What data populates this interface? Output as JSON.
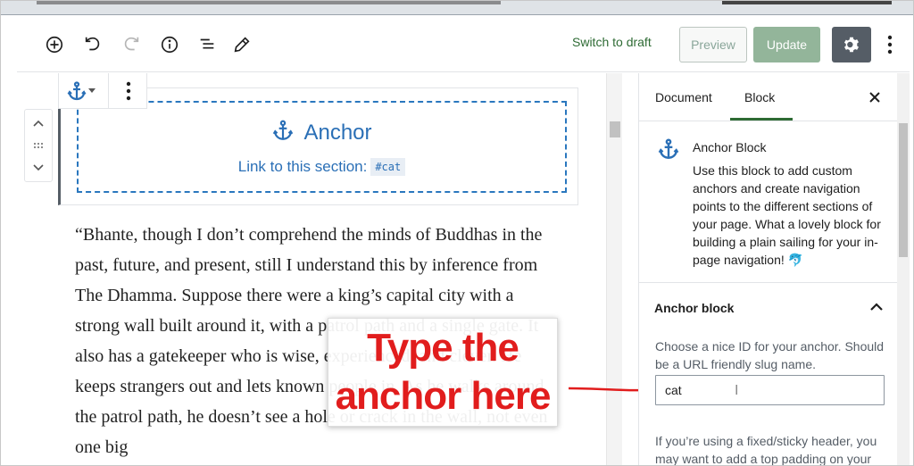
{
  "header": {
    "switch_to_draft": "Switch to draft",
    "preview": "Preview",
    "update": "Update",
    "icons": [
      "add-block-icon",
      "undo-icon",
      "redo-icon",
      "info-icon",
      "list-view-icon",
      "edit-pencil-icon",
      "gear-icon",
      "more-vertical-icon"
    ]
  },
  "block": {
    "title": "Anchor",
    "link_label": "Link to this section:",
    "anchor_code": "#cat"
  },
  "paragraph": "“Bhante, though I don’t comprehend the minds of Buddhas in the past, future, and present, still I understand this by inference from The Dhamma. Suppose there were a king’s capital city with a strong wall built around it, with a patrol path and a single gate. It also has a gatekeeper who is wise, experienced, and clever. He keeps strangers out and lets known people in. As he walks around the patrol path, he doesn’t see a hole or crack in the wall, not even one big",
  "callout": {
    "line1": "Type the",
    "line2": "anchor here"
  },
  "sidebar": {
    "tabs": [
      "Document",
      "Block"
    ],
    "active_tab": "Block",
    "card_title": "Anchor Block",
    "card_desc": "Use this block to add custom anchors and create navigation points to the different sections of your page. What a lovely block for building a plain sailing for your in-page navigation!",
    "card_emoji": "🐬",
    "panel_title": "Anchor block",
    "help_text": "Choose a nice ID for your anchor. Should be a URL friendly slug name.",
    "input_value": "cat",
    "help_text_2": "If you’re using a fixed/sticky header, you may want to add a top padding on your"
  },
  "colors": {
    "accent_green": "#2e6b34",
    "anchor_blue": "#2a6fb6",
    "callout_red": "#e11d1d",
    "update_button": "#93b59a",
    "settings_button": "#555d66"
  }
}
